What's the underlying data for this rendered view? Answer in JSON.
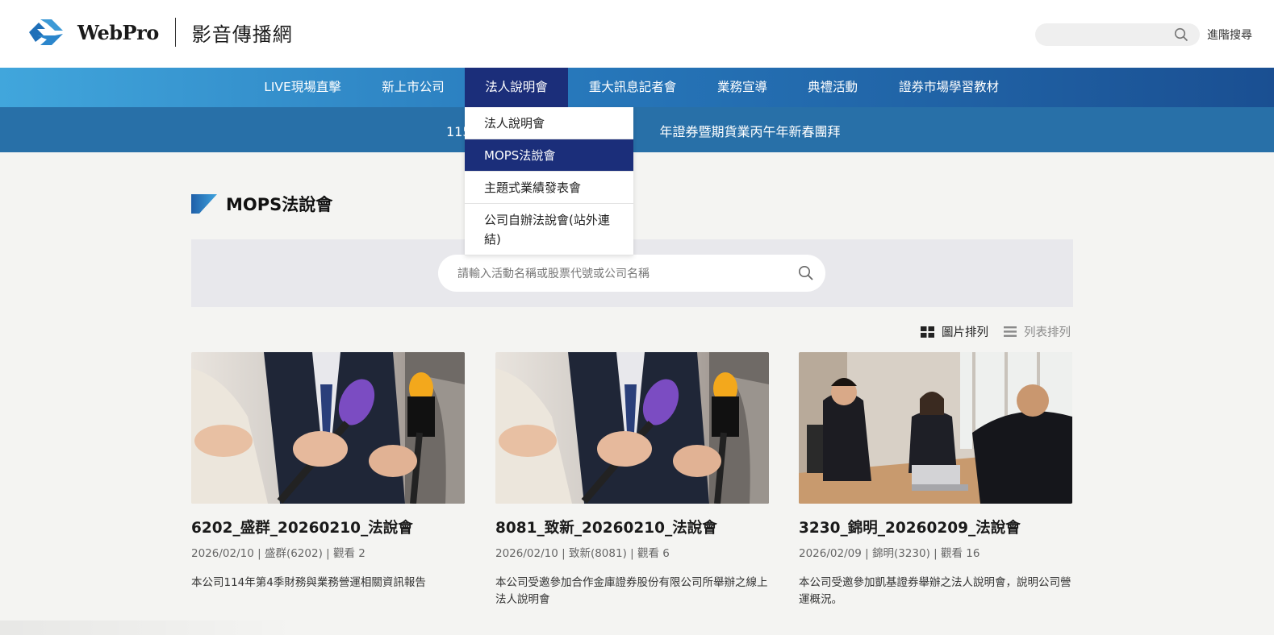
{
  "header": {
    "brand": "WebPro",
    "site_name": "影音傳播網",
    "search_placeholder": "",
    "advanced_search_label": "進階搜尋"
  },
  "nav": {
    "items": [
      {
        "label": "LIVE現場直擊"
      },
      {
        "label": "新上市公司"
      },
      {
        "label": "法人說明會"
      },
      {
        "label": "重大訊息記者會"
      },
      {
        "label": "業務宣導"
      },
      {
        "label": "典禮活動"
      },
      {
        "label": "證券市場學習教材"
      }
    ],
    "active_item": "法人說明會"
  },
  "marquee": {
    "text": "115                                              年證券暨期貨業丙午年新春團拜"
  },
  "dropdown": {
    "items": [
      {
        "label": "法人說明會"
      },
      {
        "label": "MOPS法說會"
      },
      {
        "label": "主題式業績發表會"
      },
      {
        "label": "公司自辦法說會(站外連結)"
      }
    ],
    "active_item": "MOPS法說會"
  },
  "section": {
    "title": "MOPS法說會"
  },
  "search": {
    "placeholder": "請輸入活動名稱或股票代號或公司名稱"
  },
  "view_toggle": {
    "grid_label": "圖片排列",
    "list_label": "列表排列",
    "active": "grid"
  },
  "cards": [
    {
      "title": "6202_盛群_20260210_法說會",
      "meta": "2026/02/10 | 盛群(6202) | 觀看 2",
      "description": "本公司114年第4季財務與業務營運相關資訊報告",
      "image": "press-microphones"
    },
    {
      "title": "8081_致新_20260210_法說會",
      "meta": "2026/02/10 | 致新(8081) | 觀看 6",
      "description": "本公司受邀參加合作金庫證券股份有限公司所舉辦之線上法人說明會",
      "image": "press-microphones"
    },
    {
      "title": "3230_錦明_20260209_法說會",
      "meta": "2026/02/09 | 錦明(3230) | 觀看 16",
      "description": "本公司受邀參加凱基證券舉辦之法人說明會，說明公司營運概況。",
      "image": "business-meeting"
    }
  ],
  "colors": {
    "nav_gradient_start": "#41a6dc",
    "nav_gradient_end": "#1a4f92",
    "nav_active": "#1b2e7a",
    "marquee_bg": "#2870a8",
    "page_bg": "#f4f4f2"
  }
}
